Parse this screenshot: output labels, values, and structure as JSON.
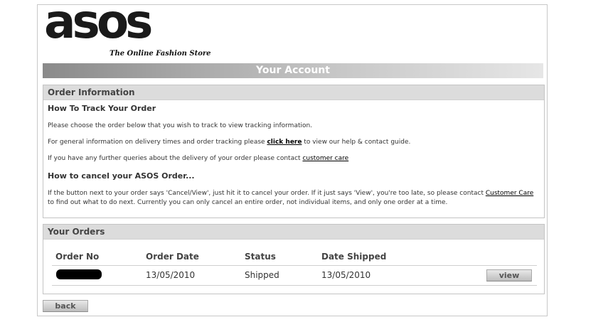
{
  "brand": {
    "logo_text": "asos",
    "tagline": "The Online Fashion Store"
  },
  "account_bar": {
    "title": "Your Account"
  },
  "order_information": {
    "header": "Order Information",
    "track_heading": "How To Track Your Order",
    "track_line": "Please choose the order below that you wish to track to view tracking information.",
    "delivery_pre": "For general information on delivery times and order tracking please ",
    "delivery_link": "click here",
    "delivery_post": " to view our help & contact guide.",
    "queries_pre": "If you have any further queries about the delivery of your order please contact ",
    "queries_link": "customer care",
    "cancel_heading": "How to cancel your ASOS Order...",
    "cancel_pre": "If the button next to your order says 'Cancel/View', just hit it to cancel your order. If it just says 'View', you're too late, so please contact ",
    "cancel_link": "Customer Care",
    "cancel_post": " to find out what to do next. Currently you can only cancel an entire order, not individual items, and only one order at a time."
  },
  "your_orders": {
    "header": "Your Orders",
    "columns": [
      "Order No",
      "Order Date",
      "Status",
      "Date Shipped"
    ],
    "rows": [
      {
        "order_date": "13/05/2010",
        "status": "Shipped",
        "date_shipped": "13/05/2010",
        "action": "view"
      }
    ]
  },
  "footer": {
    "back_label": "back"
  }
}
